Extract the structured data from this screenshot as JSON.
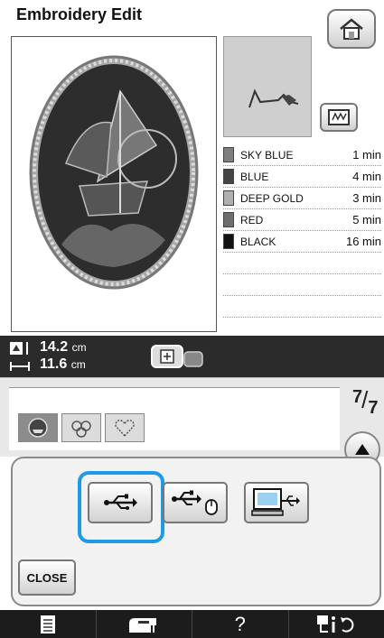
{
  "header": {
    "title": "Embroidery Edit"
  },
  "colors": [
    {
      "name": "SKY BLUE",
      "time": "1 min",
      "swatch": "#7f7f7f"
    },
    {
      "name": "BLUE",
      "time": "4 min",
      "swatch": "#444444"
    },
    {
      "name": "DEEP GOLD",
      "time": "3 min",
      "swatch": "#b0b0b0"
    },
    {
      "name": "RED",
      "time": "5 min",
      "swatch": "#6e6e6e"
    },
    {
      "name": "BLACK",
      "time": "16 min",
      "swatch": "#111111"
    }
  ],
  "size": {
    "height": "14.2",
    "width": "11.6",
    "unit": "cm"
  },
  "page": {
    "current": "7",
    "total": "7"
  },
  "media_buttons": [
    {
      "icon": "usb-icon"
    },
    {
      "icon": "usb-mouse-icon"
    },
    {
      "icon": "computer-usb-icon"
    }
  ],
  "close_label": "CLOSE",
  "bottom_bar": [
    {
      "icon": "document-icon"
    },
    {
      "icon": "sewing-machine-icon"
    },
    {
      "icon": "help-icon",
      "label": "?"
    },
    {
      "icon": "settings-info-icon"
    }
  ],
  "accent": "#1e9be8"
}
